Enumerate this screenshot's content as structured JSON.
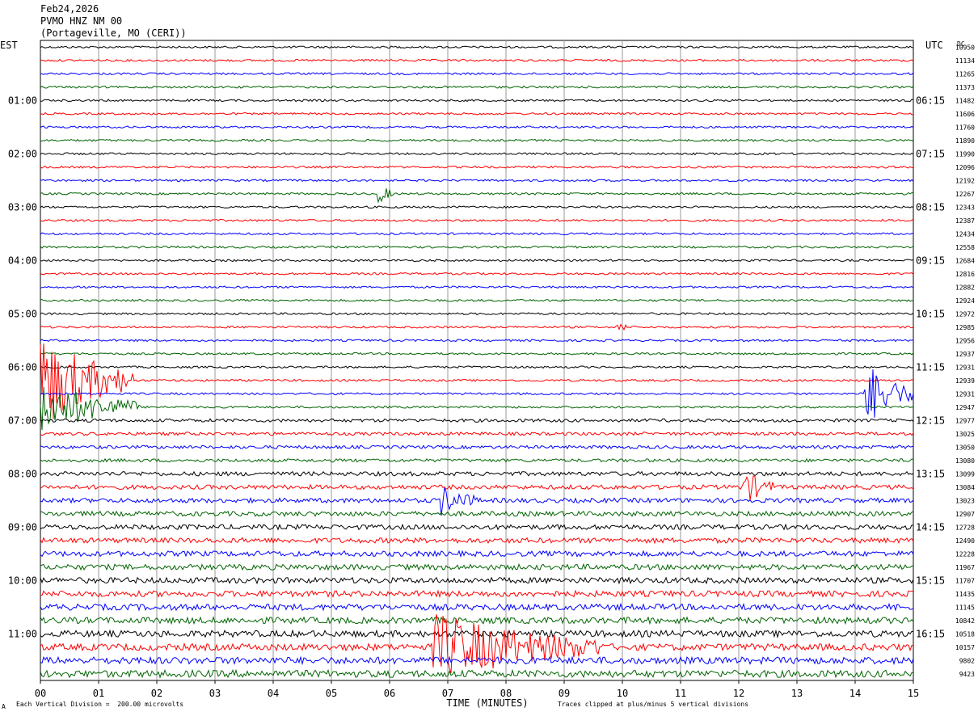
{
  "header": {
    "date": "Feb24,2026",
    "station": "PVMO HNZ NM 00",
    "location": "(Portageville, MO (CERI))"
  },
  "chart_data": {
    "type": "line",
    "title": "",
    "left_tz_label": "EST",
    "right_tz_label": "UTC",
    "dc_header": "DC",
    "xlabel": "TIME (MINUTES)",
    "xlim": [
      0,
      15
    ],
    "x_ticks": [
      "00",
      "01",
      "02",
      "03",
      "04",
      "05",
      "06",
      "07",
      "08",
      "09",
      "10",
      "11",
      "12",
      "13",
      "14",
      "15"
    ],
    "trace_colors": [
      "#000000",
      "#ff0000",
      "#0000ff",
      "#006400"
    ],
    "trace_count": 48,
    "left_hour_labels": [
      "01:00",
      "02:00",
      "03:00",
      "04:00",
      "05:00",
      "06:00",
      "07:00",
      "08:00",
      "09:00",
      "10:00",
      "11:00"
    ],
    "right_hour_labels": [
      "06:15",
      "07:15",
      "08:15",
      "09:15",
      "10:15",
      "11:15",
      "12:15",
      "13:15",
      "14:15",
      "15:15",
      "16:15"
    ],
    "dc_offsets": [
      "10950",
      "11134",
      "11265",
      "11373",
      "11482",
      "11606",
      "11760",
      "11890",
      "11990",
      "12096",
      "12192",
      "12267",
      "12343",
      "12387",
      "12434",
      "12558",
      "12684",
      "12816",
      "12882",
      "12924",
      "12972",
      "12985",
      "12956",
      "12937",
      "12931",
      "12939",
      "12931",
      "12947",
      "12977",
      "13025",
      "13050",
      "13080",
      "13099",
      "13084",
      "13023",
      "12907",
      "12728",
      "12490",
      "12228",
      "11967",
      "11707",
      "11435",
      "11145",
      "10842",
      "10518",
      "10157",
      "9802",
      "9423"
    ],
    "events": [
      {
        "trace": 11,
        "minute": 5.85,
        "amplitude": 1.6,
        "duration_min": 0.25
      },
      {
        "trace": 21,
        "minute": 9.95,
        "amplitude": 1.2,
        "duration_min": 0.15
      },
      {
        "trace": 25,
        "minute": 0.0,
        "amplitude": 9,
        "duration_min": 1.6
      },
      {
        "trace": 27,
        "minute": 0.0,
        "amplitude": 5,
        "duration_min": 1.7
      },
      {
        "trace": 26,
        "minute": 14.2,
        "amplitude": 6,
        "duration_min": 0.8
      },
      {
        "trace": 33,
        "minute": 12.1,
        "amplitude": 3,
        "duration_min": 0.5
      },
      {
        "trace": 34,
        "minute": 6.9,
        "amplitude": 2.5,
        "duration_min": 0.6
      },
      {
        "trace": 45,
        "minute": 6.8,
        "amplitude": 6,
        "duration_min": 2.8
      }
    ],
    "grid": true
  },
  "footer": {
    "scale_note": "Each Vertical Division =  200.00 microvolts",
    "clip_note": "Traces clipped at plus/minus 5 vertical divisions",
    "corner_mark": "A"
  }
}
